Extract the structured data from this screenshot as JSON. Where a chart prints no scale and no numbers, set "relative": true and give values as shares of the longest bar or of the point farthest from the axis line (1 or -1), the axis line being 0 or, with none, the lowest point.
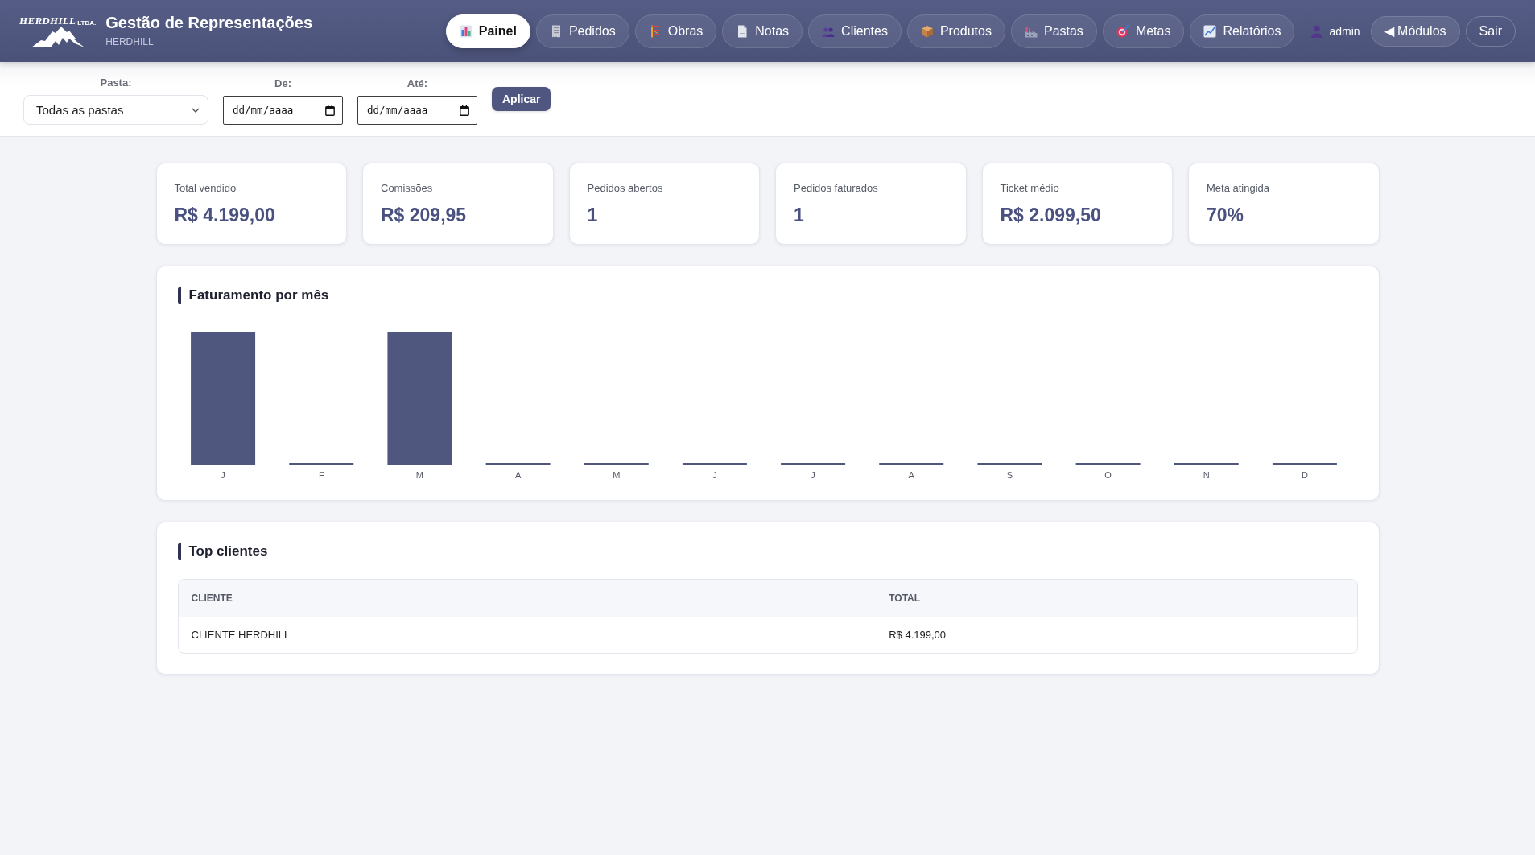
{
  "header": {
    "logo": {
      "name": "HERDHILL",
      "suffix": "LTDA."
    },
    "title": "Gestão de Representações",
    "subtitle": "HERDHILL",
    "nav": [
      {
        "label": "Painel",
        "selected": true
      },
      {
        "label": "Pedidos",
        "selected": false
      },
      {
        "label": "Obras",
        "selected": false
      },
      {
        "label": "Notas",
        "selected": false
      },
      {
        "label": "Clientes",
        "selected": false
      },
      {
        "label": "Produtos",
        "selected": false
      },
      {
        "label": "Pastas",
        "selected": false
      },
      {
        "label": "Metas",
        "selected": false
      },
      {
        "label": "Relatórios",
        "selected": false
      }
    ],
    "user": "admin",
    "buttons": [
      {
        "label": "◀ Módulos",
        "kind": "filled"
      },
      {
        "label": "Sair",
        "kind": "outline"
      }
    ]
  },
  "filters": {
    "folder": {
      "label": "Pasta:",
      "value": "Todas as pastas"
    },
    "date_from": {
      "label": "De:",
      "placeholder": "dd/mm/aaaa"
    },
    "date_to": {
      "label": "Até:",
      "placeholder": "dd/mm/aaaa"
    },
    "apply_button": "Aplicar"
  },
  "stats": [
    {
      "label": "Total vendido",
      "value": "R$ 4.199,00"
    },
    {
      "label": "Comissões",
      "value": "R$ 209,95"
    },
    {
      "label": "Pedidos abertos",
      "value": "1"
    },
    {
      "label": "Pedidos faturados",
      "value": "1"
    },
    {
      "label": "Ticket médio",
      "value": "R$ 2.099,50"
    },
    {
      "label": "Meta atingida",
      "value": "70%"
    }
  ],
  "revenue_chart": {
    "chart_data": {
      "type": "bar",
      "title": "Faturamento por mês",
      "relative": true,
      "categories": [
        "J",
        "F",
        "M",
        "A",
        "M",
        "J",
        "J",
        "A",
        "S",
        "O",
        "N",
        "D"
      ],
      "values": [
        1,
        0,
        1,
        0,
        0,
        0,
        0,
        0,
        0,
        0,
        0,
        0
      ]
    }
  },
  "top_clients": {
    "title": "Top clientes",
    "columns": [
      "CLIENTE",
      "TOTAL"
    ],
    "rows": [
      [
        "CLIENTE HERDHILL",
        "R$ 4.199,00"
      ]
    ]
  }
}
